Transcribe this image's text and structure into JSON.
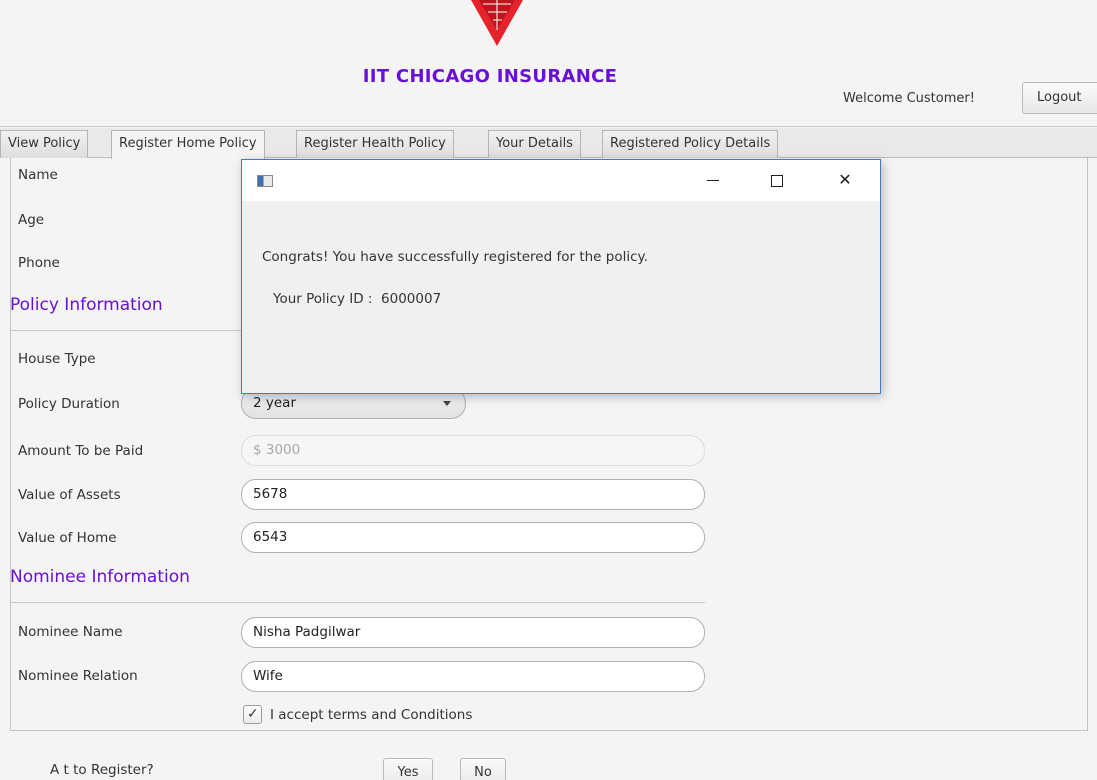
{
  "header": {
    "app_title": "IIT CHICAGO INSURANCE",
    "welcome_text": "Welcome Customer!",
    "logout_label": "Logout",
    "brand_color": "#6a0fd6",
    "logo_icon": "red-chevron-logo"
  },
  "tabs": [
    {
      "label": "View Policy",
      "active": false
    },
    {
      "label": "Register Home Policy",
      "active": true
    },
    {
      "label": "Register Health Policy",
      "active": false
    },
    {
      "label": "Your Details",
      "active": false
    },
    {
      "label": "Registered Policy Details",
      "active": false
    }
  ],
  "form": {
    "name_label": "Name",
    "age_label": "Age",
    "phone_label": "Phone",
    "policy_section": "Policy Information",
    "house_type_label": "House Type",
    "policy_duration_label": "Policy Duration",
    "policy_duration_value": "2 year",
    "amount_label": "Amount To be Paid",
    "amount_value": "$ 3000",
    "assets_label": "Value of Assets",
    "assets_value": "5678",
    "home_label": "Value of Home",
    "home_value": "6543",
    "nominee_section": "Nominee Information",
    "nominee_name_label": "Nominee Name",
    "nominee_name_value": "Nisha Padgilwar",
    "nominee_relation_label": "Nominee Relation",
    "nominee_relation_value": "Wife",
    "terms_label": "I accept terms and Conditions",
    "terms_checked": true
  },
  "bottom": {
    "question": "A                          t to Register?",
    "yes_label": "Yes",
    "no_label": "No"
  },
  "dialog": {
    "minimize_icon": "minimize-icon",
    "maximize_icon": "maximize-icon",
    "close_glyph": "✕",
    "message": "Congrats! You have successfully registered for the policy.",
    "policy_id_text": "Your Policy ID :  6000007",
    "border_color": "#3c7ec6"
  }
}
